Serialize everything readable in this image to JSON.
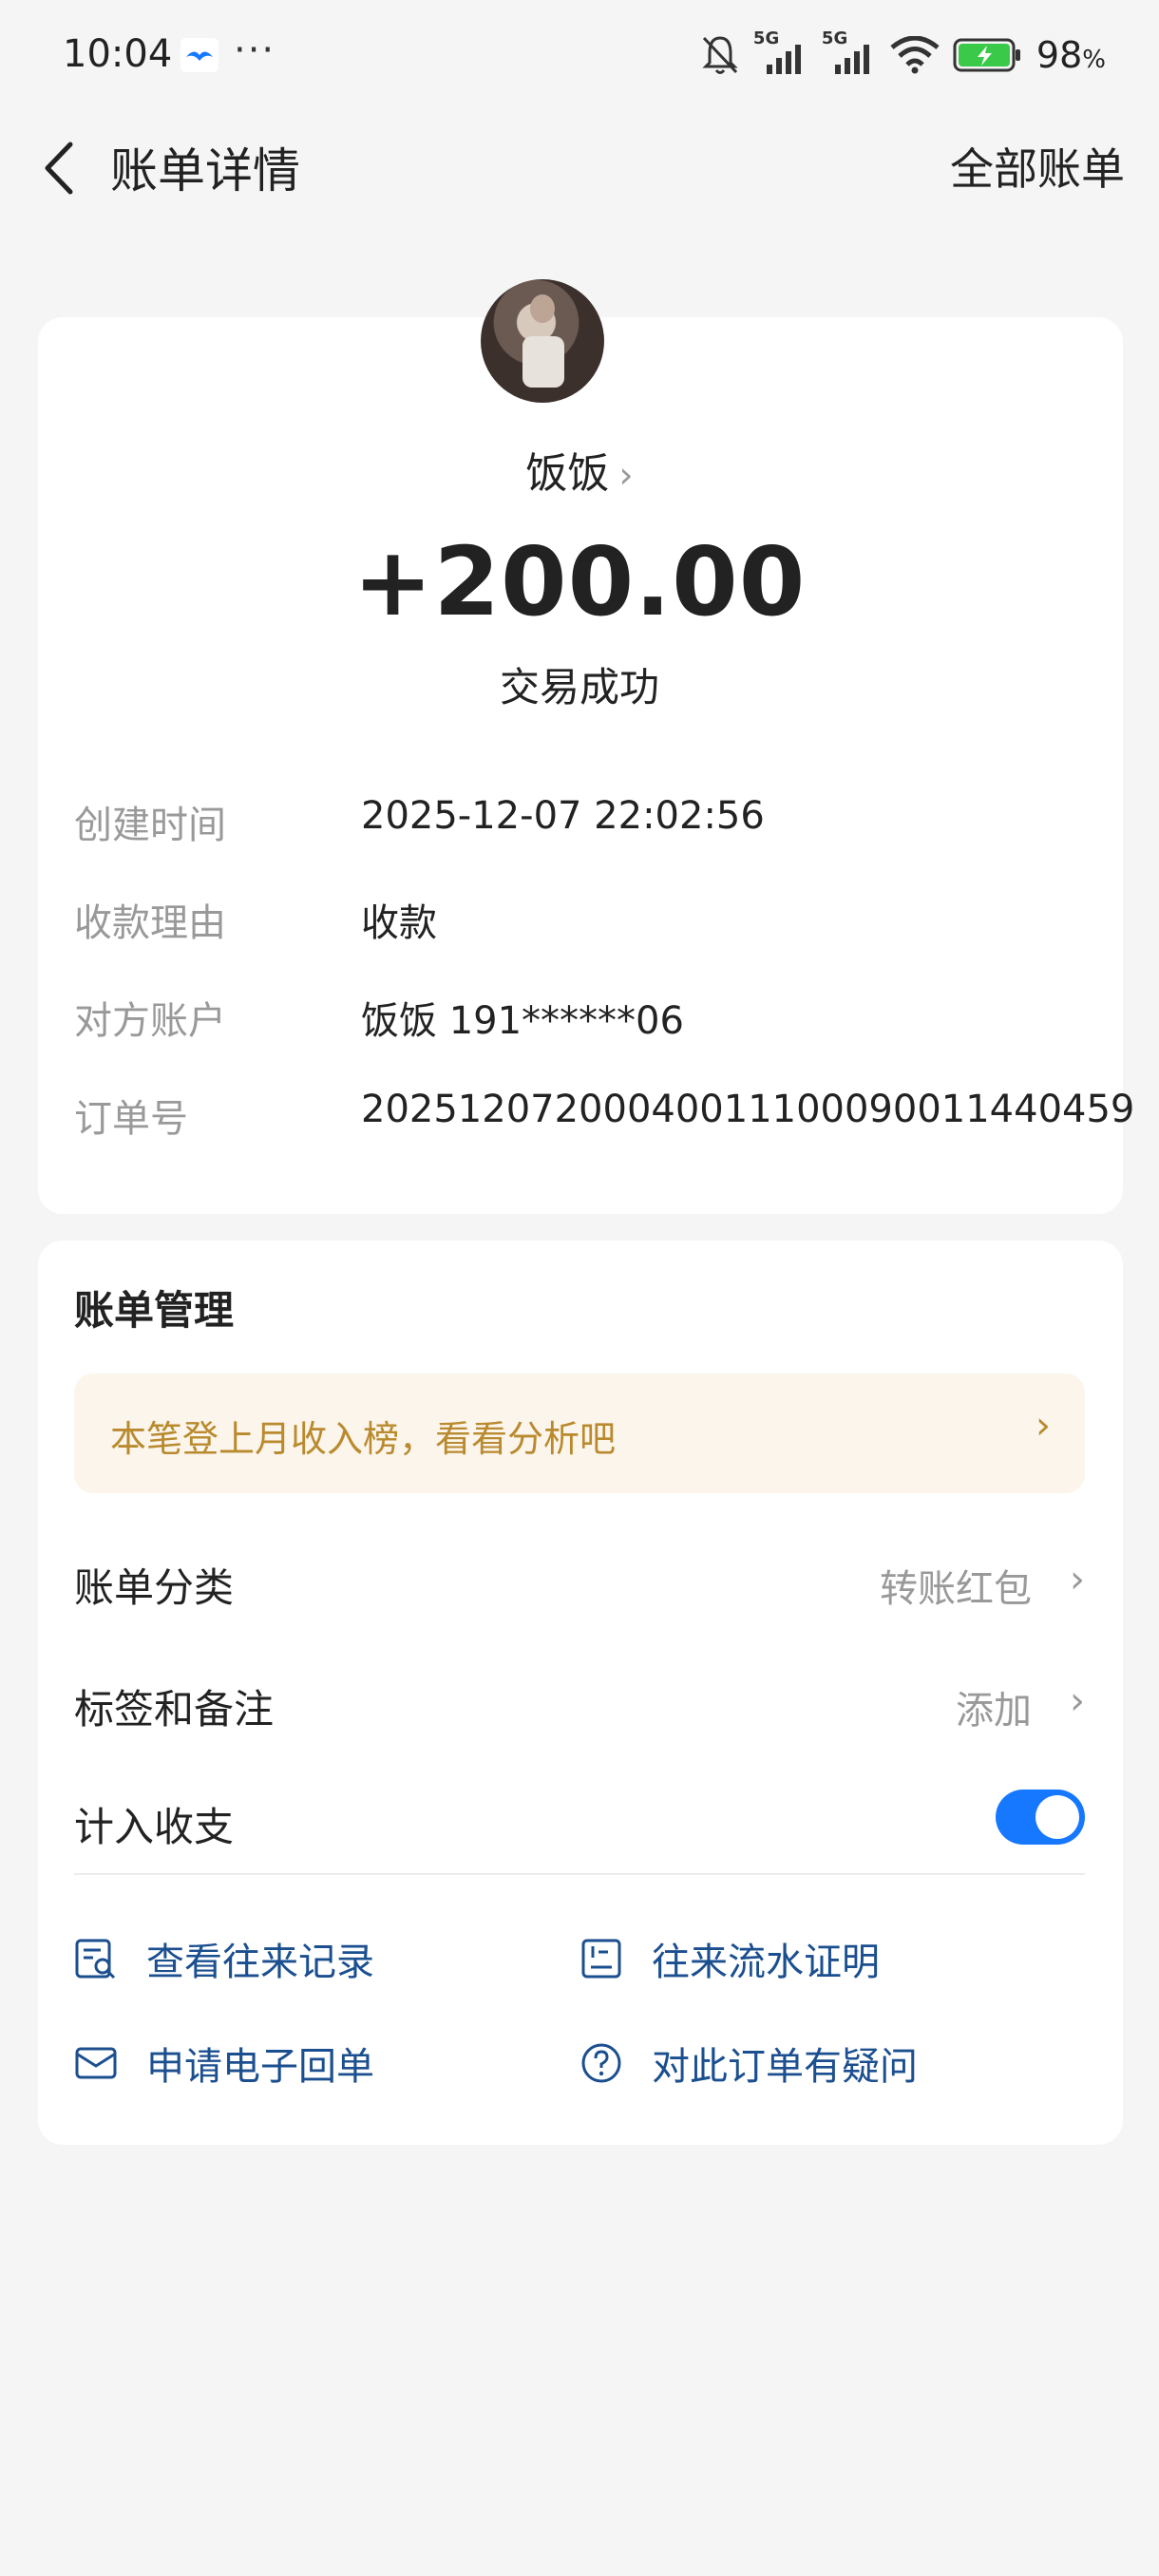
{
  "status_bar": {
    "time": "10:04",
    "dots": "···",
    "network_1": "5G",
    "network_2": "5G",
    "battery_percent": "98",
    "battery_unit": "%"
  },
  "header": {
    "title": "账单详情",
    "right_link": "全部账单"
  },
  "transaction": {
    "payee_name": "饭饭",
    "amount": "+200.00",
    "status": "交易成功",
    "details": [
      {
        "label": "创建时间",
        "value": "2025-12-07 22:02:56"
      },
      {
        "label": "收款理由",
        "value": "收款"
      },
      {
        "label": "对方账户",
        "value": "饭饭 191******06"
      },
      {
        "label": "订单号",
        "value": "20251207200040011100090011440459"
      }
    ]
  },
  "management": {
    "title": "账单管理",
    "promo_text": "本笔登上月收入榜，看看分析吧",
    "category_label": "账单分类",
    "category_value": "转账红包",
    "tags_label": "标签和备注",
    "tags_value": "添加",
    "include_label": "计入收支",
    "include_enabled": true,
    "links": [
      {
        "label": "查看往来记录",
        "icon": "search-record-icon"
      },
      {
        "label": "往来流水证明",
        "icon": "statement-icon"
      },
      {
        "label": "申请电子回单",
        "icon": "mail-icon"
      },
      {
        "label": "对此订单有疑问",
        "icon": "question-icon"
      }
    ]
  },
  "colors": {
    "accent": "#1677ff",
    "link": "#1b4f8f",
    "promo_text": "#b98a2e",
    "promo_bg": "#fbf5ec",
    "page_bg": "#f5f5f5"
  }
}
